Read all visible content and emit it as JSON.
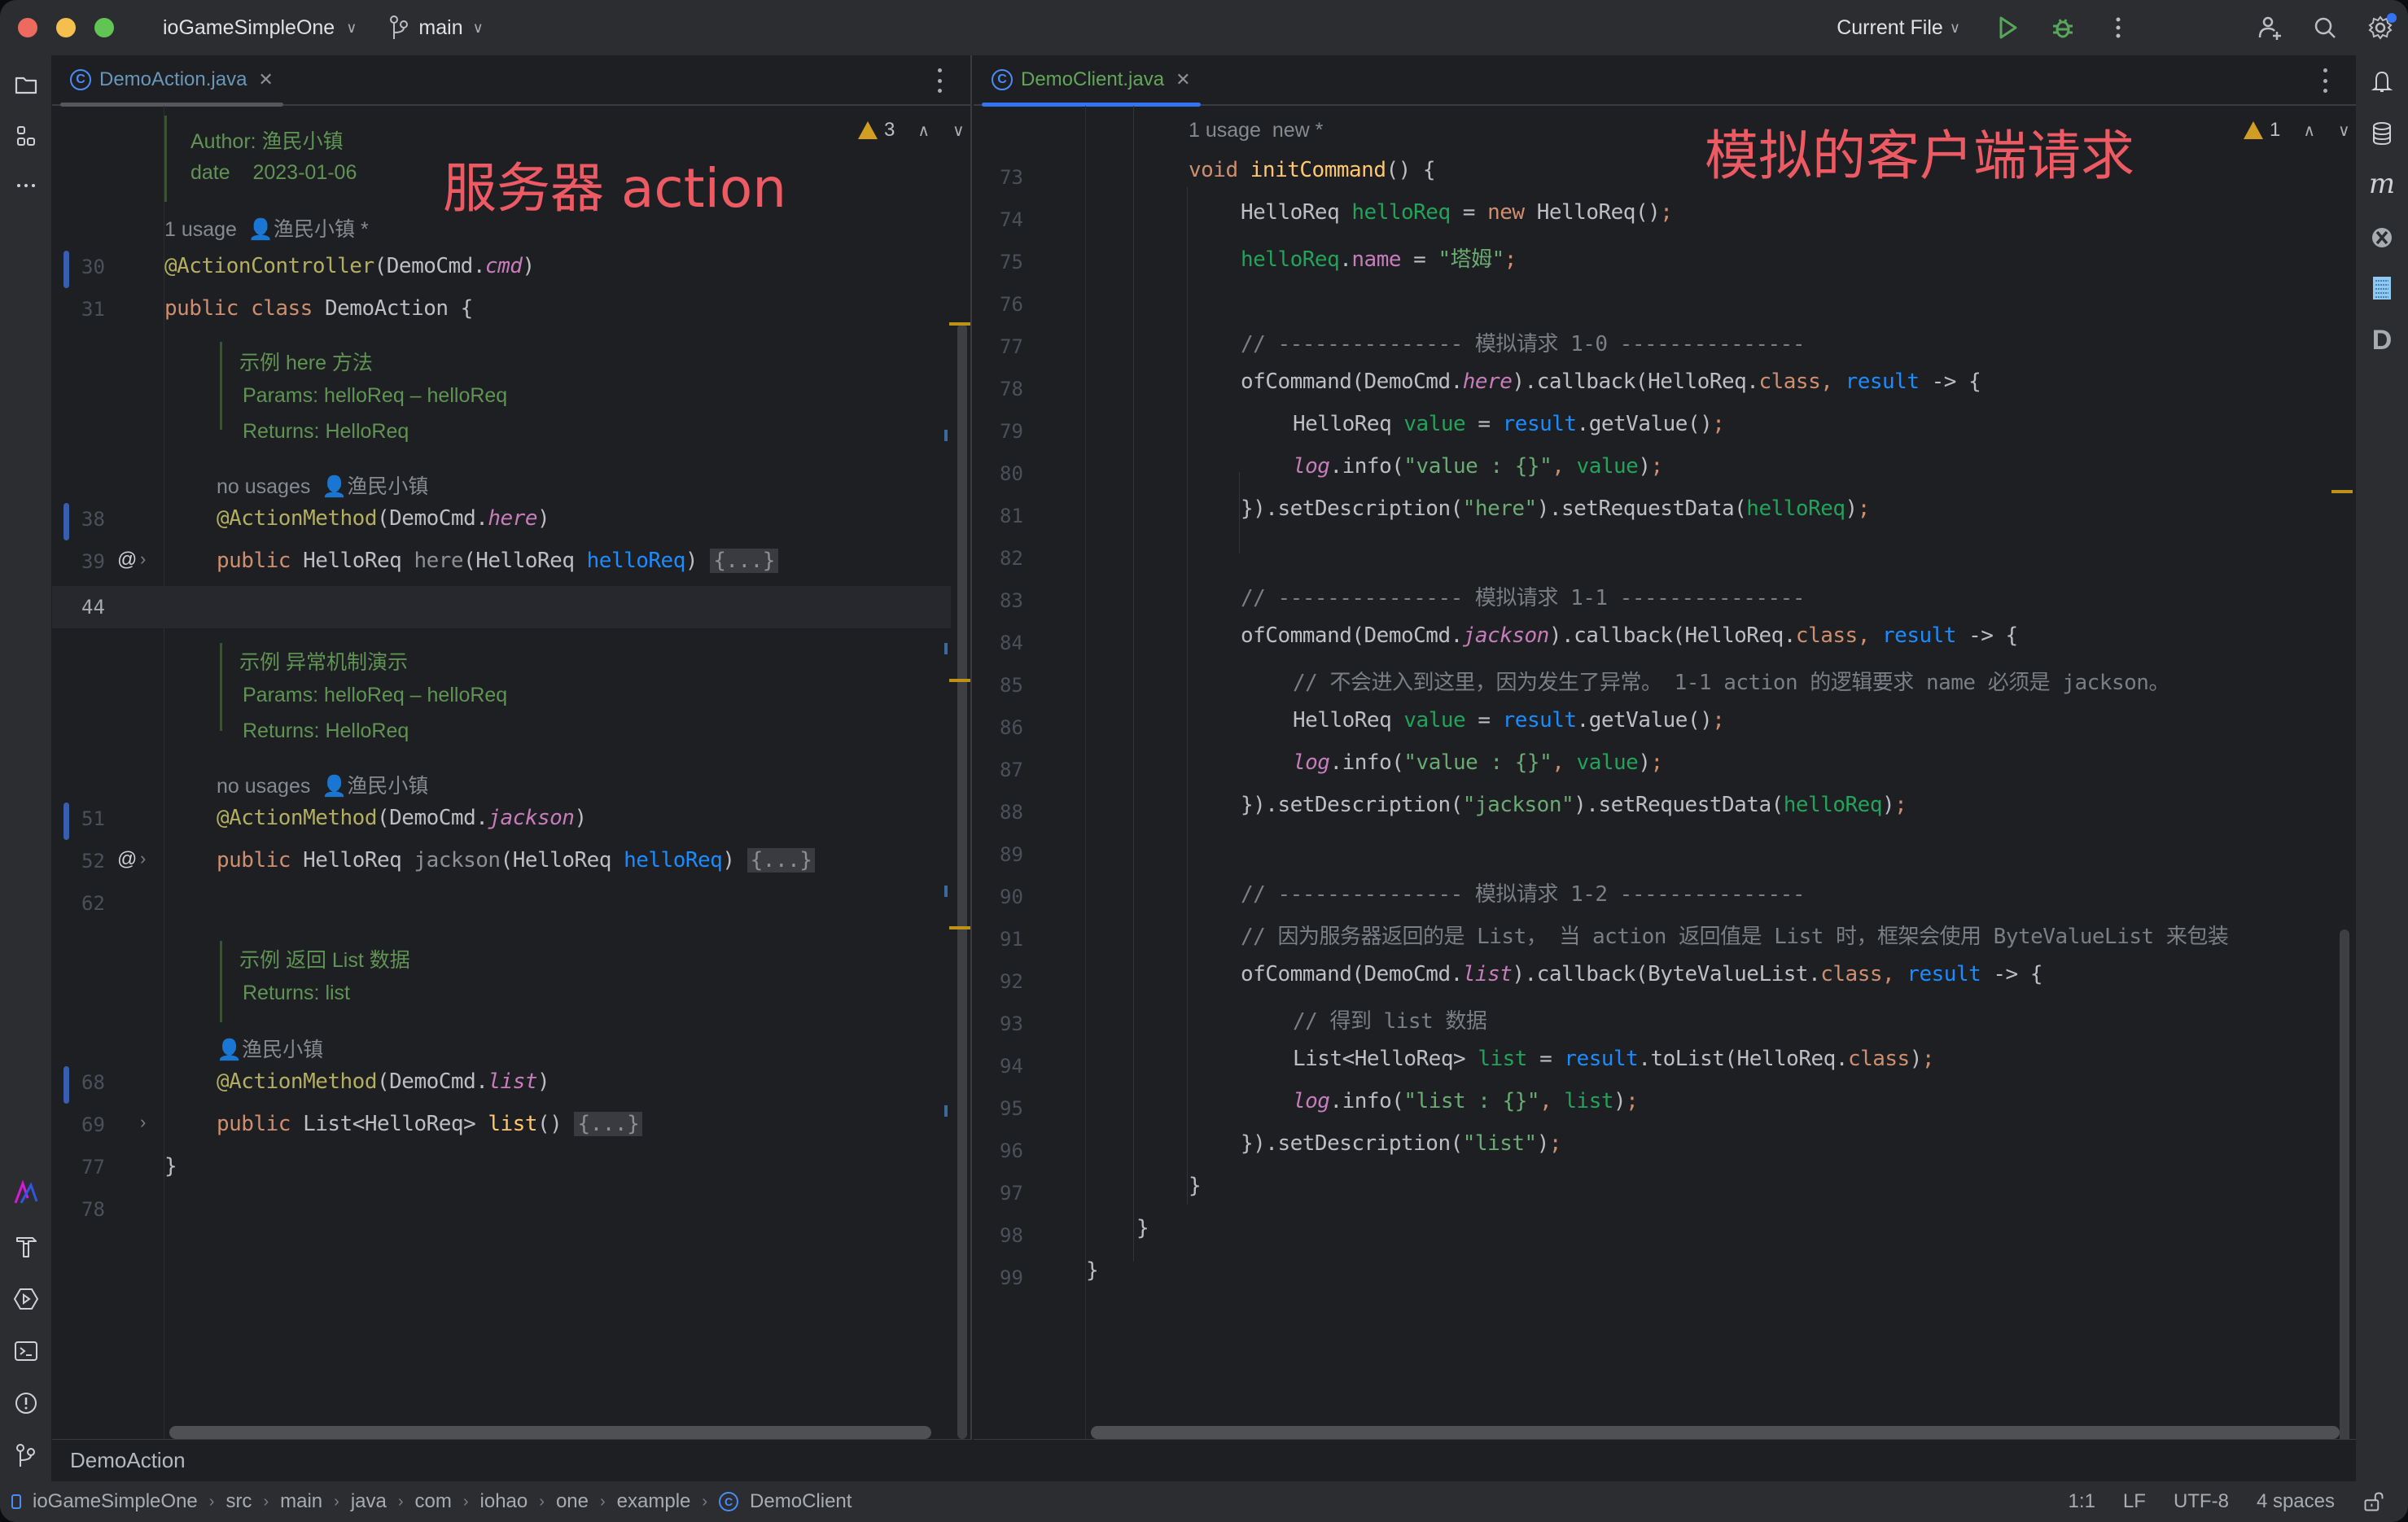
{
  "titlebar": {
    "project": "ioGameSimpleOne",
    "branch": "main",
    "run_config": "Current File"
  },
  "left_editor": {
    "tab": {
      "label": "DemoAction.java",
      "color": "#6897bb"
    },
    "overlay_title": "服务器 action",
    "inspection": {
      "warnings": "3"
    },
    "doc_header": {
      "author_label": "Author:",
      "author": "渔民小镇",
      "date_label": "date",
      "date": "2023-01-06"
    },
    "hint_class": {
      "usages": "1 usage",
      "author": "渔民小镇 *"
    },
    "lines": [
      {
        "num": "30",
        "code": "@ActionController(DemoCmd.cmd)"
      },
      {
        "num": "31",
        "code": "public class DemoAction {"
      },
      {
        "num": "38",
        "code": "@ActionMethod(DemoCmd.here)"
      },
      {
        "num": "39",
        "code": "public HelloReq here(HelloReq helloReq) {...}"
      },
      {
        "num": "44",
        "code": ""
      },
      {
        "num": "51",
        "code": "@ActionMethod(DemoCmd.jackson)"
      },
      {
        "num": "52",
        "code": "public HelloReq jackson(HelloReq helloReq) {...}"
      },
      {
        "num": "62",
        "code": ""
      },
      {
        "num": "68",
        "code": "@ActionMethod(DemoCmd.list)"
      },
      {
        "num": "69",
        "code": "public List<HelloReq> list() {...}"
      },
      {
        "num": "77",
        "code": "}"
      },
      {
        "num": "78",
        "code": ""
      }
    ],
    "docs": [
      {
        "title": "示例 here 方法",
        "params_label": "Params:",
        "params": "helloReq – helloReq",
        "returns_label": "Returns:",
        "returns": "HelloReq",
        "usages": "no usages",
        "author": "渔民小镇"
      },
      {
        "title": "示例 异常机制演示",
        "params_label": "Params:",
        "params": "helloReq – helloReq",
        "returns_label": "Returns:",
        "returns": "HelloReq",
        "usages": "no usages",
        "author": "渔民小镇"
      },
      {
        "title": "示例 返回 List 数据",
        "returns_label": "Returns:",
        "returns": "list",
        "author": "渔民小镇"
      }
    ],
    "structure_label": "DemoAction"
  },
  "right_editor": {
    "tab": {
      "label": "DemoClient.java",
      "color": "#62a65a"
    },
    "overlay_title": "模拟的客户端请求",
    "inspection": {
      "warnings": "1"
    },
    "hint_method": {
      "usages": "1 usage",
      "author": "new *"
    },
    "lines": [
      {
        "num": "73",
        "code": "void initCommand() {"
      },
      {
        "num": "74",
        "code": "HelloReq helloReq = new HelloReq();"
      },
      {
        "num": "75",
        "code": "helloReq.name = \"塔姆\";"
      },
      {
        "num": "76",
        "code": ""
      },
      {
        "num": "77",
        "code": "// --------------- 模拟请求 1-0 ---------------"
      },
      {
        "num": "78",
        "code": "ofCommand(DemoCmd.here).callback(HelloReq.class, result -> {"
      },
      {
        "num": "79",
        "code": "HelloReq value = result.getValue();"
      },
      {
        "num": "80",
        "code": "log.info(\"value : {}\", value);"
      },
      {
        "num": "81",
        "code": "}).setDescription(\"here\").setRequestData(helloReq);"
      },
      {
        "num": "82",
        "code": ""
      },
      {
        "num": "83",
        "code": "// --------------- 模拟请求 1-1 ---------------"
      },
      {
        "num": "84",
        "code": "ofCommand(DemoCmd.jackson).callback(HelloReq.class, result -> {"
      },
      {
        "num": "85",
        "code": "// 不会进入到这里，因为发生了异常。 1-1 action 的逻辑要求 name 必须是 jackson。"
      },
      {
        "num": "86",
        "code": "HelloReq value = result.getValue();"
      },
      {
        "num": "87",
        "code": "log.info(\"value : {}\", value);"
      },
      {
        "num": "88",
        "code": "}).setDescription(\"jackson\").setRequestData(helloReq);"
      },
      {
        "num": "89",
        "code": ""
      },
      {
        "num": "90",
        "code": "// --------------- 模拟请求 1-2 ---------------"
      },
      {
        "num": "91",
        "code": "// 因为服务器返回的是 List， 当 action 返回值是 List 时，框架会使用 ByteValueList 来包装"
      },
      {
        "num": "92",
        "code": "ofCommand(DemoCmd.list).callback(ByteValueList.class, result -> {"
      },
      {
        "num": "93",
        "code": "// 得到 list 数据"
      },
      {
        "num": "94",
        "code": "List<HelloReq> list = result.toList(HelloReq.class);"
      },
      {
        "num": "95",
        "code": "log.info(\"list : {}\", list);"
      },
      {
        "num": "96",
        "code": "}).setDescription(\"list\");"
      },
      {
        "num": "97",
        "code": "}"
      },
      {
        "num": "98",
        "code": "}"
      },
      {
        "num": "99",
        "code": "}"
      }
    ]
  },
  "statusbar": {
    "breadcrumbs": [
      "ioGameSimpleOne",
      "src",
      "main",
      "java",
      "com",
      "iohao",
      "one",
      "example",
      "DemoClient"
    ],
    "position": "1:1",
    "line_separator": "LF",
    "encoding": "UTF-8",
    "indent": "4 spaces"
  },
  "icons": {
    "left_stripe_top": [
      "folder-icon",
      "structure-icon",
      "more-icon"
    ],
    "left_stripe_bottom": [
      "plugin-logo-icon",
      "build-icon",
      "services-icon",
      "terminal-icon",
      "problems-icon",
      "git-icon"
    ],
    "right_stripe": [
      "notifications-icon",
      "database-icon",
      "maven-icon",
      "plugin-x-icon",
      "binary-icon",
      "d-icon"
    ]
  }
}
